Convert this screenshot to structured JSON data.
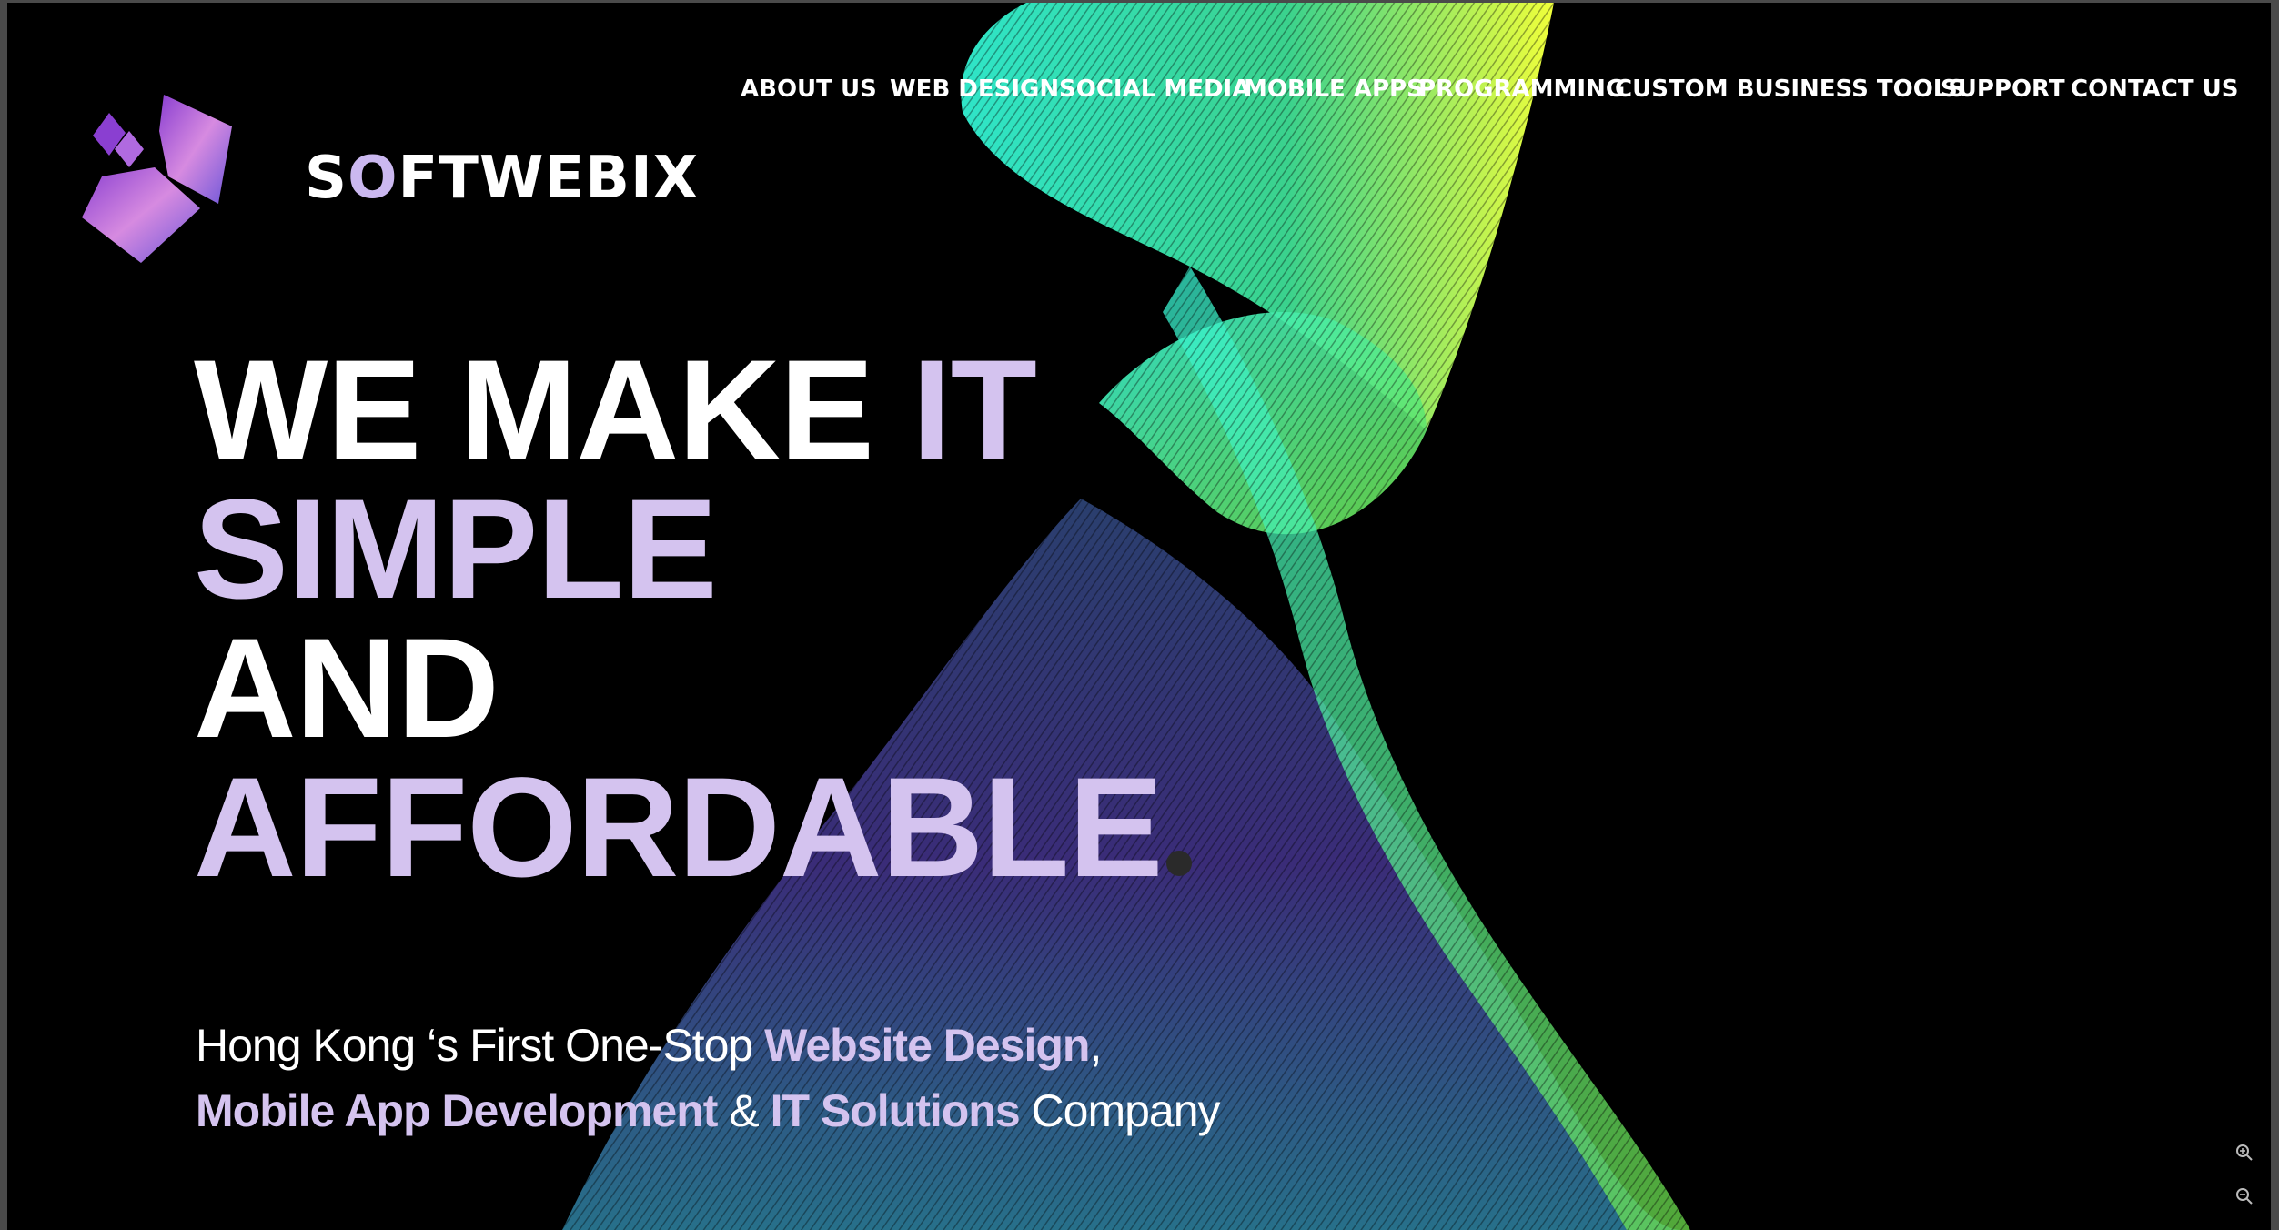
{
  "brand": {
    "name_prefix": "S",
    "name_o": "O",
    "name_rest": "FTWEBIX",
    "logo_colors": [
      "#8a3fd1",
      "#d68ae0",
      "#6a55d8"
    ]
  },
  "nav": {
    "items": [
      {
        "label": "ABOUT US"
      },
      {
        "label": "WEB DESIGN"
      },
      {
        "label": "SOCIAL MEDIA"
      },
      {
        "label": "MOBILE APPS"
      },
      {
        "label": "PROGRAMMING"
      },
      {
        "label": "CUSTOM BUSINESS TOOLS"
      },
      {
        "label": "SUPPORT"
      },
      {
        "label": "CONTACT US"
      }
    ]
  },
  "hero": {
    "line1_white": "WE MAKE ",
    "line1_accent": "IT",
    "line2": "SIMPLE",
    "line3": "AND",
    "line4": "AFFORDABLE",
    "sub_line1_plain": "Hong Kong ‘s First One-Stop ",
    "sub_line1_bold": "Website Design",
    "sub_line1_tail": ",",
    "sub_line2_bold1": "Mobile App Development",
    "sub_line2_amp": " & ",
    "sub_line2_bold2": "IT Solutions",
    "sub_line2_tail": " Company"
  },
  "controls": {
    "zoom_in_icon": "zoom-in-icon",
    "zoom_out_icon": "zoom-out-icon"
  },
  "colors": {
    "background": "#000000",
    "accent": "#d4c3ef",
    "text": "#ffffff"
  }
}
